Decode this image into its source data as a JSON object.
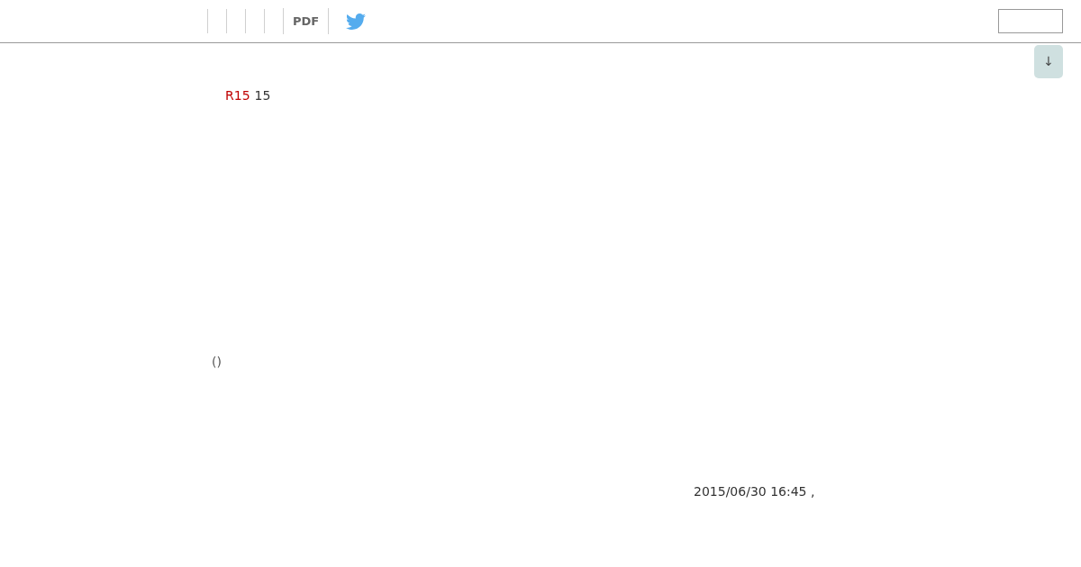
{
  "header": {
    "nav": [
      {
        "label": "PDF"
      }
    ]
  },
  "scroll_button": {
    "label": "↓"
  },
  "article": {
    "title_tag": "R15",
    "title": "15",
    "caption": "()",
    "timestamp": "2015/06/30 16:45 ,"
  }
}
